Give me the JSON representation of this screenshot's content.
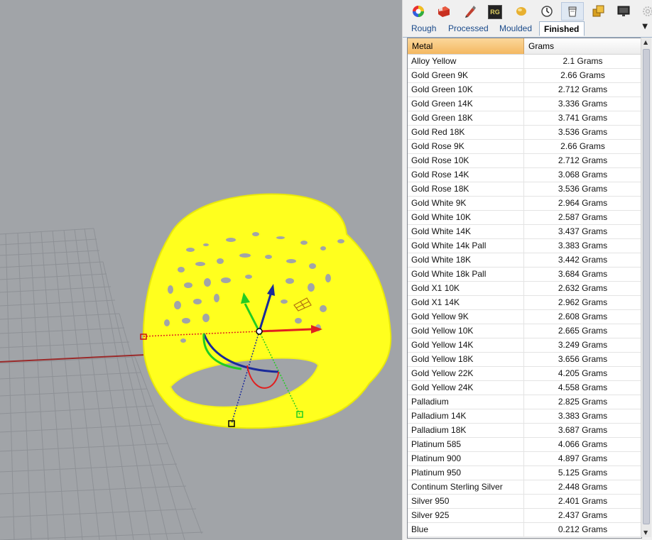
{
  "toolbar": {
    "icons": [
      "color-wheel-icon",
      "render-icon",
      "pen-icon",
      "rg-icon",
      "gold-blob-icon",
      "clock-icon",
      "metal-weight-icon",
      "gold-tiles-icon",
      "monitor-icon",
      "settings-icon"
    ],
    "rg_text": "RG"
  },
  "tabs": [
    {
      "label": "Rough",
      "active": false
    },
    {
      "label": "Processed",
      "active": false
    },
    {
      "label": "Moulded",
      "active": false
    },
    {
      "label": "Finished",
      "active": true
    }
  ],
  "table": {
    "headers": {
      "metal": "Metal",
      "grams": "Grams"
    },
    "rows": [
      {
        "metal": "Alloy Yellow",
        "grams": "2.1 Grams"
      },
      {
        "metal": "Gold Green 9K",
        "grams": "2.66 Grams"
      },
      {
        "metal": "Gold Green 10K",
        "grams": "2.712 Grams"
      },
      {
        "metal": "Gold Green 14K",
        "grams": "3.336 Grams"
      },
      {
        "metal": "Gold Green 18K",
        "grams": "3.741 Grams"
      },
      {
        "metal": "Gold Red 18K",
        "grams": "3.536 Grams"
      },
      {
        "metal": "Gold Rose 9K",
        "grams": "2.66 Grams"
      },
      {
        "metal": "Gold Rose 10K",
        "grams": "2.712 Grams"
      },
      {
        "metal": "Gold Rose 14K",
        "grams": "3.068 Grams"
      },
      {
        "metal": "Gold Rose 18K",
        "grams": "3.536 Grams"
      },
      {
        "metal": "Gold White 9K",
        "grams": "2.964 Grams"
      },
      {
        "metal": "Gold White 10K",
        "grams": "2.587 Grams"
      },
      {
        "metal": "Gold White 14K",
        "grams": "3.437 Grams"
      },
      {
        "metal": "Gold White 14k Pall",
        "grams": "3.383 Grams"
      },
      {
        "metal": "Gold White 18K",
        "grams": "3.442 Grams"
      },
      {
        "metal": "Gold White 18k Pall",
        "grams": "3.684 Grams"
      },
      {
        "metal": "Gold X1 10K",
        "grams": "2.632 Grams"
      },
      {
        "metal": "Gold X1 14K",
        "grams": "2.962 Grams"
      },
      {
        "metal": "Gold Yellow 9K",
        "grams": "2.608 Grams"
      },
      {
        "metal": "Gold Yellow 10K",
        "grams": "2.665 Grams"
      },
      {
        "metal": "Gold Yellow 14K",
        "grams": "3.249 Grams"
      },
      {
        "metal": "Gold Yellow 18K",
        "grams": "3.656 Grams"
      },
      {
        "metal": "Gold Yellow 22K",
        "grams": "4.205 Grams"
      },
      {
        "metal": "Gold Yellow 24K",
        "grams": "4.558 Grams"
      },
      {
        "metal": "Palladium",
        "grams": "2.825 Grams"
      },
      {
        "metal": "Palladium 14K",
        "grams": "3.383 Grams"
      },
      {
        "metal": "Palladium 18K",
        "grams": "3.687 Grams"
      },
      {
        "metal": "Platinum 585",
        "grams": "4.066 Grams"
      },
      {
        "metal": "Platinum 900",
        "grams": "4.897 Grams"
      },
      {
        "metal": "Platinum 950",
        "grams": "5.125 Grams"
      },
      {
        "metal": "Continum Sterling Silver",
        "grams": "2.448 Grams"
      },
      {
        "metal": "Silver 950",
        "grams": "2.401 Grams"
      },
      {
        "metal": "Silver 925",
        "grams": "2.437 Grams"
      },
      {
        "metal": "Blue",
        "grams": "0.212 Grams"
      }
    ]
  },
  "colors": {
    "viewport_bg": "#a1a4a8",
    "ring_yellow": "#ffff1e",
    "header_metal": "#f4b861",
    "gizmo_red": "#e02020",
    "gizmo_green": "#22cc22",
    "gizmo_blue": "#1a2a9a"
  }
}
